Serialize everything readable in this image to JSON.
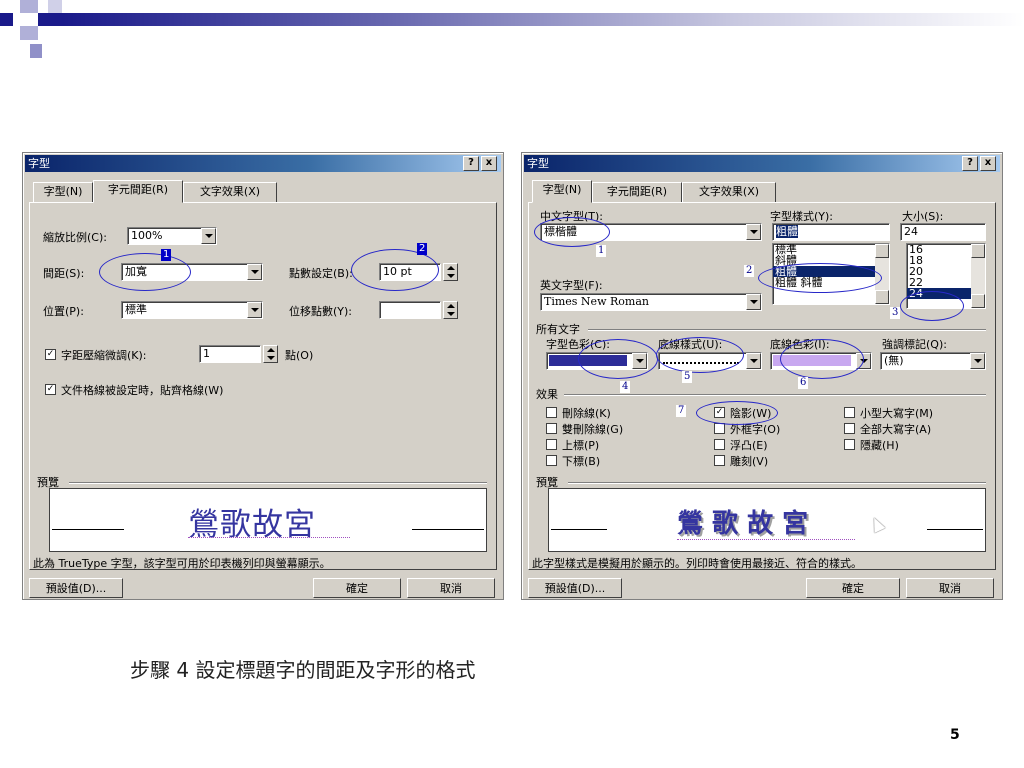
{
  "slide": {
    "caption": "步驟 4 設定標題字的間距及字形的格式",
    "page_number": "5",
    "colors": {
      "accent": "#1a1a8a",
      "annotation": "#2828c8"
    }
  },
  "left_dialog": {
    "title": "字型",
    "help_btn": "?",
    "close_btn": "x",
    "tabs": [
      "字型(N)",
      "字元間距(R)",
      "文字效果(X)"
    ],
    "scale_label": "縮放比例(C):",
    "scale_value": "100%",
    "spacing_label": "間距(S):",
    "spacing_value": "加寬",
    "points_label": "點數設定(B):",
    "points_value": "10 pt",
    "position_label": "位置(P):",
    "position_value": "標準",
    "offset_label": "位移點數(Y):",
    "offset_value": "",
    "kerning_label": "字距壓縮微調(K):",
    "kerning_value": "1",
    "kerning_unit": "點(O)",
    "grid_label": "文件格線被設定時，貼齊格線(W)",
    "preview_label": "預覽",
    "preview_text": "鶯歌故宮",
    "footer_text": "此為 TrueType 字型，該字型可用於印表機列印與螢幕顯示。",
    "default_btn": "預設值(D)...",
    "ok_btn": "確定",
    "cancel_btn": "取消",
    "marks": [
      "1",
      "2"
    ]
  },
  "right_dialog": {
    "title": "字型",
    "help_btn": "?",
    "close_btn": "x",
    "tabs": [
      "字型(N)",
      "字元間距(R)",
      "文字效果(X)"
    ],
    "cn_font_label": "中文字型(T):",
    "cn_font_value": "標楷體",
    "style_label": "字型樣式(Y):",
    "style_value": "粗體",
    "size_label": "大小(S):",
    "size_value": "24",
    "style_list": [
      "標準",
      "斜體",
      "粗體",
      "粗體 斜體"
    ],
    "size_list": [
      "16",
      "18",
      "20",
      "22",
      "24"
    ],
    "en_font_label": "英文字型(F):",
    "en_font_value": "Times New Roman",
    "all_text_label": "所有文字",
    "color_label": "字型色彩(C):",
    "underline_label": "底線樣式(U):",
    "underline_color_label": "底線色彩(I):",
    "emphasis_label": "強調標記(Q):",
    "emphasis_value": "(無)",
    "effects_label": "效果",
    "effects": [
      {
        "label": "刪除線(K)",
        "checked": false
      },
      {
        "label": "雙刪除線(G)",
        "checked": false
      },
      {
        "label": "上標(P)",
        "checked": false
      },
      {
        "label": "下標(B)",
        "checked": false
      },
      {
        "label": "陰影(W)",
        "checked": true
      },
      {
        "label": "外框字(O)",
        "checked": false
      },
      {
        "label": "浮凸(E)",
        "checked": false
      },
      {
        "label": "雕刻(V)",
        "checked": false
      },
      {
        "label": "小型大寫字(M)",
        "checked": false
      },
      {
        "label": "全部大寫字(A)",
        "checked": false
      },
      {
        "label": "隱藏(H)",
        "checked": false
      }
    ],
    "preview_label": "預覽",
    "preview_text": "鶯 歌 故 宮",
    "footer_text": "此字型樣式是模擬用於顯示的。列印時會使用最接近、符合的樣式。",
    "default_btn": "預設值(D)...",
    "ok_btn": "確定",
    "cancel_btn": "取消",
    "marks": [
      "1",
      "2",
      "3",
      "4",
      "5",
      "6",
      "7"
    ],
    "colors": {
      "font_color": "#2c2c98",
      "underline_color": "#c8a8f0"
    }
  }
}
